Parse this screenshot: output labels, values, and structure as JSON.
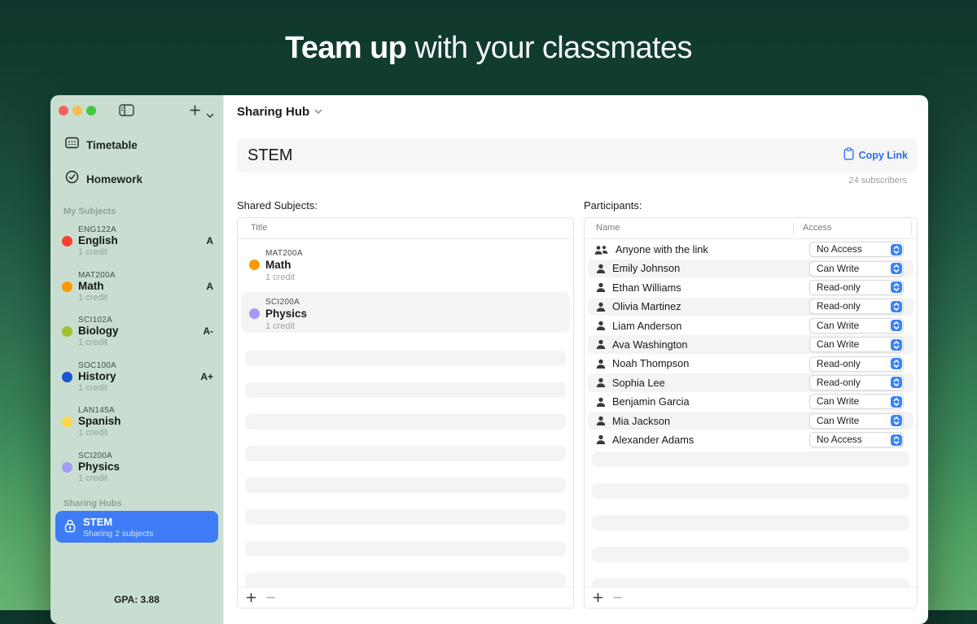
{
  "hero": {
    "title_bold": "Team up",
    "title_rest": " with your classmates"
  },
  "sidebar": {
    "nav": {
      "timetable": "Timetable",
      "homework": "Homework"
    },
    "subjects_header": "My Subjects",
    "subjects": [
      {
        "code": "ENG122A",
        "name": "English",
        "credits": "1 credit",
        "grade": "A",
        "color": "#f93f33"
      },
      {
        "code": "MAT200A",
        "name": "Math",
        "credits": "1 credit",
        "grade": "A",
        "color": "#fb9a00"
      },
      {
        "code": "SCI102A",
        "name": "Biology",
        "credits": "1 credit",
        "grade": "A-",
        "color": "#9fc131"
      },
      {
        "code": "SOC100A",
        "name": "History",
        "credits": "1 credit",
        "grade": "A+",
        "color": "#1b55d0"
      },
      {
        "code": "LAN145A",
        "name": "Spanish",
        "credits": "1 credit",
        "grade": "",
        "color": "#fcd848"
      },
      {
        "code": "SCI200A",
        "name": "Physics",
        "credits": "1 credit",
        "grade": "",
        "color": "#a49bf5"
      }
    ],
    "hubs_header": "Sharing Hubs",
    "hub": {
      "name": "STEM",
      "subtitle": "Sharing 2 subjects"
    },
    "gpa": "GPA: 3.88"
  },
  "main": {
    "title": "Sharing Hub",
    "hub_name": "STEM",
    "copy_link_label": "Copy Link",
    "subscribers": "24 subscribers",
    "shared_subjects": {
      "label": "Shared Subjects:",
      "column_title": "Title",
      "rows": [
        {
          "code": "MAT200A",
          "name": "Math",
          "credits": "1 credit",
          "color": "#fb9a00"
        },
        {
          "code": "SCI200A",
          "name": "Physics",
          "credits": "1 credit",
          "color": "#a49bf5"
        }
      ]
    },
    "participants": {
      "label": "Participants:",
      "columns": {
        "name": "Name",
        "access": "Access"
      },
      "rows": [
        {
          "name": "Anyone with the link",
          "access": "No Access",
          "icon": "people"
        },
        {
          "name": "Emily Johnson",
          "access": "Can Write",
          "icon": "person"
        },
        {
          "name": "Ethan Williams",
          "access": "Read-only",
          "icon": "person"
        },
        {
          "name": "Olivia Martinez",
          "access": "Read-only",
          "icon": "person"
        },
        {
          "name": "Liam Anderson",
          "access": "Can Write",
          "icon": "person"
        },
        {
          "name": "Ava Washington",
          "access": "Can Write",
          "icon": "person"
        },
        {
          "name": "Noah Thompson",
          "access": "Read-only",
          "icon": "person"
        },
        {
          "name": "Sophia Lee",
          "access": "Read-only",
          "icon": "person"
        },
        {
          "name": "Benjamin Garcia",
          "access": "Can Write",
          "icon": "person"
        },
        {
          "name": "Mia Jackson",
          "access": "Can Write",
          "icon": "person"
        },
        {
          "name": "Alexander Adams",
          "access": "No Access",
          "icon": "person"
        }
      ]
    }
  },
  "colors": {
    "accent_blue": "#3d7cf6",
    "link_blue": "#2d6cf0",
    "sidebar_green": "#c9ded1",
    "stripe_gray": "#f4f4f5"
  },
  "icons": {
    "traffic_lights": [
      "close-icon",
      "minimize-icon",
      "zoom-icon"
    ],
    "sidebar_toggle": "sidebar-toggle-icon",
    "add": "plus-icon",
    "timetable": "calendar-icon",
    "homework": "check-circle-icon",
    "hub": "lock-icon",
    "copy_link": "clipboard-icon",
    "participant": "person-icon",
    "anyone": "people-icon",
    "dropdown": "stepper-icon"
  }
}
